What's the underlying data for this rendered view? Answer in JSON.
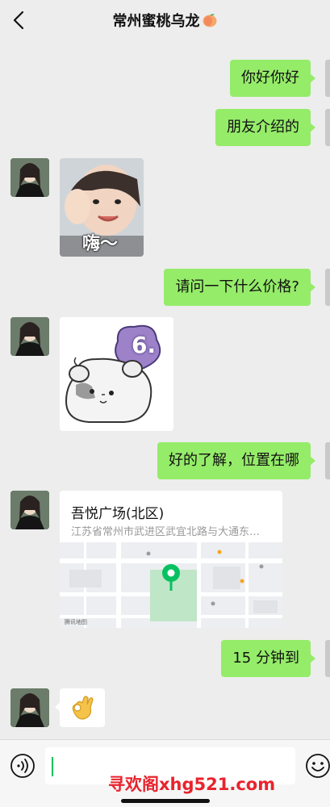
{
  "header": {
    "title": "常州蜜桃乌龙",
    "back_icon": "chevron-left-icon",
    "title_emoji": "peach-icon"
  },
  "messages": [
    {
      "side": "right",
      "type": "text",
      "text": "你好你好"
    },
    {
      "side": "right",
      "type": "text",
      "text": "朋友介绍的"
    },
    {
      "side": "left",
      "type": "sticker",
      "caption": "嗨～"
    },
    {
      "side": "right",
      "type": "text",
      "text": "请问一下什么价格?"
    },
    {
      "side": "left",
      "type": "sticker",
      "badge": "6."
    },
    {
      "side": "right",
      "type": "text",
      "text": "好的了解，位置在哪"
    },
    {
      "side": "left",
      "type": "location",
      "title": "吾悦广场(北区)",
      "address": "江苏省常州市武进区武宜北路与大通东…",
      "map_caption": "腾讯地图"
    },
    {
      "side": "right",
      "type": "text",
      "text": "15 分钟到"
    },
    {
      "side": "left",
      "type": "emoji",
      "icon": "ok-hand-icon"
    }
  ],
  "input_bar": {
    "voice_icon": "voice-icon",
    "emoji_icon": "smiley-icon",
    "value": ""
  },
  "watermark": "寻欢阁xhg521.com",
  "colors": {
    "background": "#ededed",
    "sent_bubble": "#95ec69",
    "received_bubble": "#ffffff",
    "caret": "#07c160",
    "watermark": "#e8232d"
  }
}
